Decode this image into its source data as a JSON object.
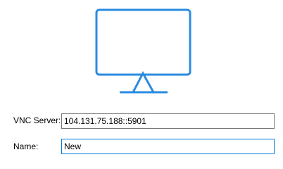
{
  "icon": "monitor-icon",
  "accent_color": "#2b8be0",
  "focus_color": "#0078d7",
  "form": {
    "server": {
      "label": "VNC Server:",
      "value": "104.131.75.188::5901"
    },
    "name": {
      "label": "Name:",
      "value": "New"
    }
  }
}
